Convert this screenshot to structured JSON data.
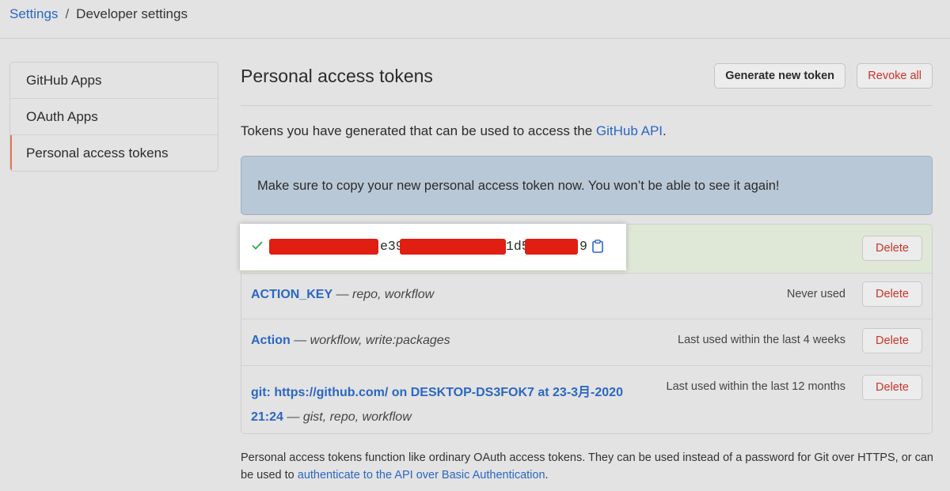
{
  "breadcrumb": {
    "parent": "Settings",
    "separator": "/",
    "current": "Developer settings"
  },
  "sidebar": {
    "items": [
      {
        "label": "GitHub Apps"
      },
      {
        "label": "OAuth Apps"
      },
      {
        "label": "Personal access tokens",
        "selected": true
      }
    ]
  },
  "header": {
    "title": "Personal access tokens",
    "generate_label": "Generate new token",
    "revoke_label": "Revoke all"
  },
  "description": {
    "prefix": "Tokens you have generated that can be used to access the ",
    "link": "GitHub API",
    "suffix": "."
  },
  "flash": {
    "message": "Make sure to copy your new personal access token now. You won’t be able to see it again!"
  },
  "new_token": {
    "visible_parts": [
      "e395",
      "1d5",
      "9"
    ],
    "redacted": true
  },
  "tokens": [
    {
      "name": "ACTION_KEY",
      "scopes": " — repo, workflow",
      "usage": "Never used"
    },
    {
      "name": "Action",
      "scopes": " — workflow, write:packages",
      "usage": "Last used within the last 4 weeks"
    },
    {
      "name_line1": "git: https://github.com/ on DESKTOP-DS3FOK7 at 23-3月-2020",
      "name_line2": "21:24",
      "scopes": " — gist, repo, workflow",
      "usage": "Last used within the last 12 months"
    }
  ],
  "delete_label": "Delete",
  "footer": {
    "text": "Personal access tokens function like ordinary OAuth access tokens. They can be used instead of a password for Git over HTTPS, or can be used to ",
    "link": "authenticate to the API over Basic Authentication",
    "suffix": "."
  },
  "colors": {
    "link": "#2a67c4",
    "danger": "#c8352b",
    "flash_bg": "#b9c8d6",
    "redaction": "#e01e12",
    "success": "#2ea44f",
    "selected_marker": "#e07a57"
  },
  "icons": {
    "check": "check-icon",
    "copy": "clipboard-icon"
  }
}
